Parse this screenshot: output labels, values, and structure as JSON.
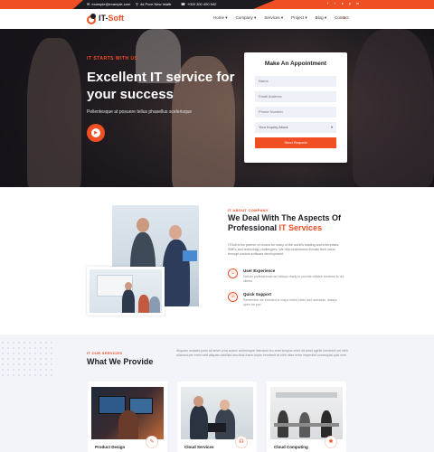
{
  "topbar": {
    "email": "example@example.com",
    "address": "4d Pvce New Istaftr",
    "phone": "+000 300 400 542",
    "social_icons": [
      "facebook-icon",
      "twitter-icon",
      "youtube-icon",
      "pinterest-icon",
      "linkedin-icon"
    ]
  },
  "header": {
    "logo_main": "IT-",
    "logo_accent": "Soft",
    "nav": [
      "Home",
      "Company",
      "Services",
      "Project",
      "Blog",
      "Contact"
    ],
    "accent_color": "#f04e23"
  },
  "hero": {
    "subtitle": "IT STARTS WITH US",
    "title": "Excellent IT service for your success",
    "text": "Pellentesque at posuere tellus phasellus scelerisque"
  },
  "appointment": {
    "title": "Make An Appointment",
    "name_placeholder": "Name",
    "email_placeholder": "Email Address",
    "phone_placeholder": "Phone Number",
    "inquiry_select": "Your Inquiry About",
    "submit_label": "Send Request"
  },
  "about": {
    "subtitle": "IT ABOUT COMPANY",
    "title_line1": "We Deal With The Aspects Of",
    "title_line2_plain": "Professional",
    "title_line2_accent": "IT Services",
    "text": "ITSoft is the partner of choice for many of the world's leading and enterprises, SMEs and technology challengers. We help businesses elevate their value through custom software development.",
    "features": [
      {
        "title": "User Experience",
        "text": "Deliver professionals we always ready to provide reliable services to our clients"
      },
      {
        "title": "Quick Support",
        "text": "Remember we included in major metro cities and overseas, always open for you"
      }
    ]
  },
  "services": {
    "subtitle": "IT OUR SERVICES",
    "title": "What We Provide",
    "text": "Aliquam sodales justo sit amet urna auctor scelerisque interdum leo anet tempus enim sit amet ogelis hendrerit vel nibh ullamcorper enim velit aliquam facilisis faucibus fusce turpis hendrerit at nibh vitae enim imperdiet consequat quis sem",
    "cards": [
      {
        "title": "Product Design"
      },
      {
        "title": "Cloud Services"
      },
      {
        "title": "Cloud Computing"
      }
    ]
  }
}
